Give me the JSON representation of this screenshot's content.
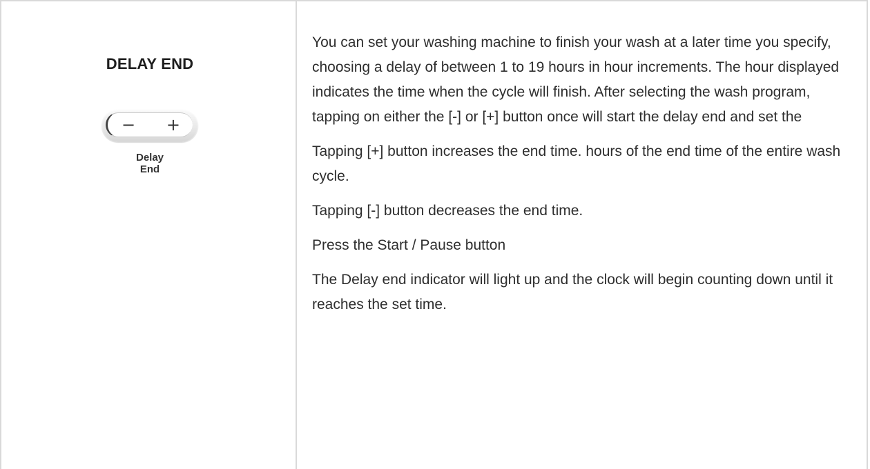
{
  "panel": {
    "heading": "DELAY END",
    "minus_symbol": "−",
    "plus_symbol": "+",
    "label_line1": "Delay",
    "label_line2": "End"
  },
  "description": {
    "paragraphs": [
      "You can set your washing machine to finish your wash at a later time you specify, choosing a delay of between 1 to 19 hours in hour increments. The hour displayed indicates the time when the cycle will finish. After selecting the wash program, tapping on either the [-] or [+] button once will start the delay end and set the",
      "Tapping [+] button increases the end time. hours of the end time of the entire wash cycle.",
      "Tapping [-] button decreases the end time.",
      "Press the Start / Pause button",
      "The Delay end indicator will light up and the clock will begin counting down until it reaches the set time."
    ]
  }
}
